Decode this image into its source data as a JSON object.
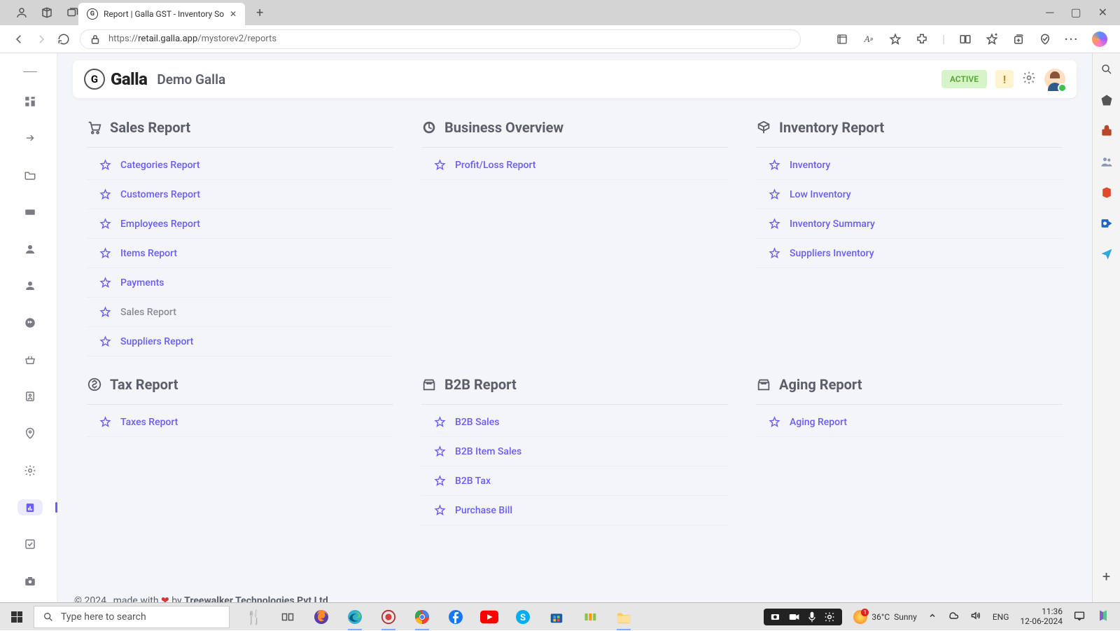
{
  "browser": {
    "tab_title": "Report | Galla GST - Inventory So",
    "url_proto": "https://",
    "url_host": "retail.galla.app",
    "url_path": "/mystorev2/reports"
  },
  "header": {
    "brand": "Galla",
    "brand_letter": "G",
    "store_name": "Demo Galla",
    "status_badge": "ACTIVE",
    "warn_badge": "!"
  },
  "sections": [
    {
      "title": "Sales Report",
      "items": [
        "Categories Report",
        "Customers Report",
        "Employees Report",
        "Items Report",
        "Payments",
        "Sales Report",
        "Suppliers Report"
      ],
      "highlight_index": 5
    },
    {
      "title": "Business Overview",
      "items": [
        "Profit/Loss Report"
      ]
    },
    {
      "title": "Inventory Report",
      "items": [
        "Inventory",
        "Low Inventory",
        "Inventory Summary",
        "Suppliers Inventory"
      ]
    },
    {
      "title": "Tax Report",
      "items": [
        "Taxes Report"
      ]
    },
    {
      "title": "B2B Report",
      "items": [
        "B2B Sales",
        "B2B Item Sales",
        "B2B Tax",
        "Purchase Bill"
      ]
    },
    {
      "title": "Aging Report",
      "items": [
        "Aging Report"
      ]
    }
  ],
  "footer": {
    "copyright": "© 2024 , made with",
    "heart": "❤",
    "by": "by",
    "company": "Treewalker Technologies Pvt Ltd"
  },
  "js_tip": "javascript:void(0)",
  "taskbar": {
    "search_placeholder": "Type here to search",
    "weather_temp": "36°C",
    "weather_desc": "Sunny",
    "lang": "ENG",
    "time": "11:36",
    "date": "12-06-2024"
  }
}
